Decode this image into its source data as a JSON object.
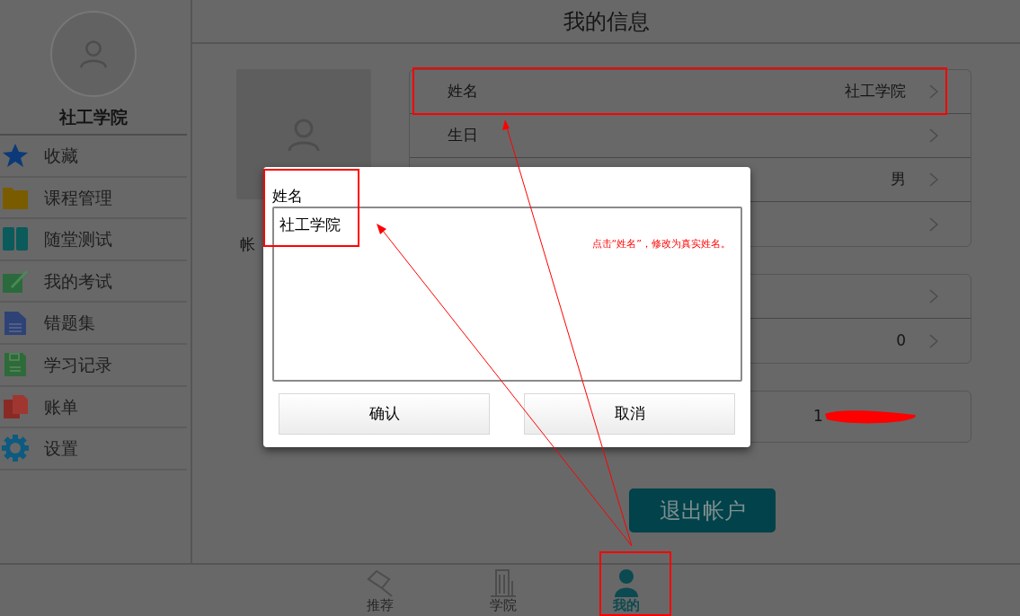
{
  "header": {
    "title": "我的信息"
  },
  "sidebar": {
    "user_name": "社工学院",
    "items": [
      {
        "label": "收藏"
      },
      {
        "label": "课程管理"
      },
      {
        "label": "随堂测试"
      },
      {
        "label": "我的考试"
      },
      {
        "label": "错题集"
      },
      {
        "label": "学习记录"
      },
      {
        "label": "账单"
      },
      {
        "label": "设置"
      }
    ]
  },
  "profile": {
    "account_label": "帐",
    "cards": [
      {
        "rows": [
          {
            "kind": "link",
            "label": "姓名",
            "value": "社工学院"
          },
          {
            "kind": "link",
            "label": "生日"
          },
          {
            "kind": "link",
            "value": "男"
          },
          {
            "kind": "link"
          }
        ]
      },
      {
        "rows": [
          {
            "kind": "link"
          },
          {
            "kind": "link",
            "value": "0"
          }
        ]
      },
      {
        "rows": [
          {
            "kind": "redacted",
            "value": "1"
          }
        ]
      }
    ]
  },
  "logout_button": "退出帐户",
  "dialog": {
    "field_label": "姓名",
    "value": "社工学院",
    "buttons": [
      "确认",
      "取消"
    ]
  },
  "annotation": {
    "note": "点击“姓名”，修改为真实姓名。"
  },
  "tabs": [
    {
      "label": "推荐",
      "selected": false
    },
    {
      "label": "学院",
      "selected": false
    },
    {
      "label": "我的",
      "selected": true
    }
  ]
}
